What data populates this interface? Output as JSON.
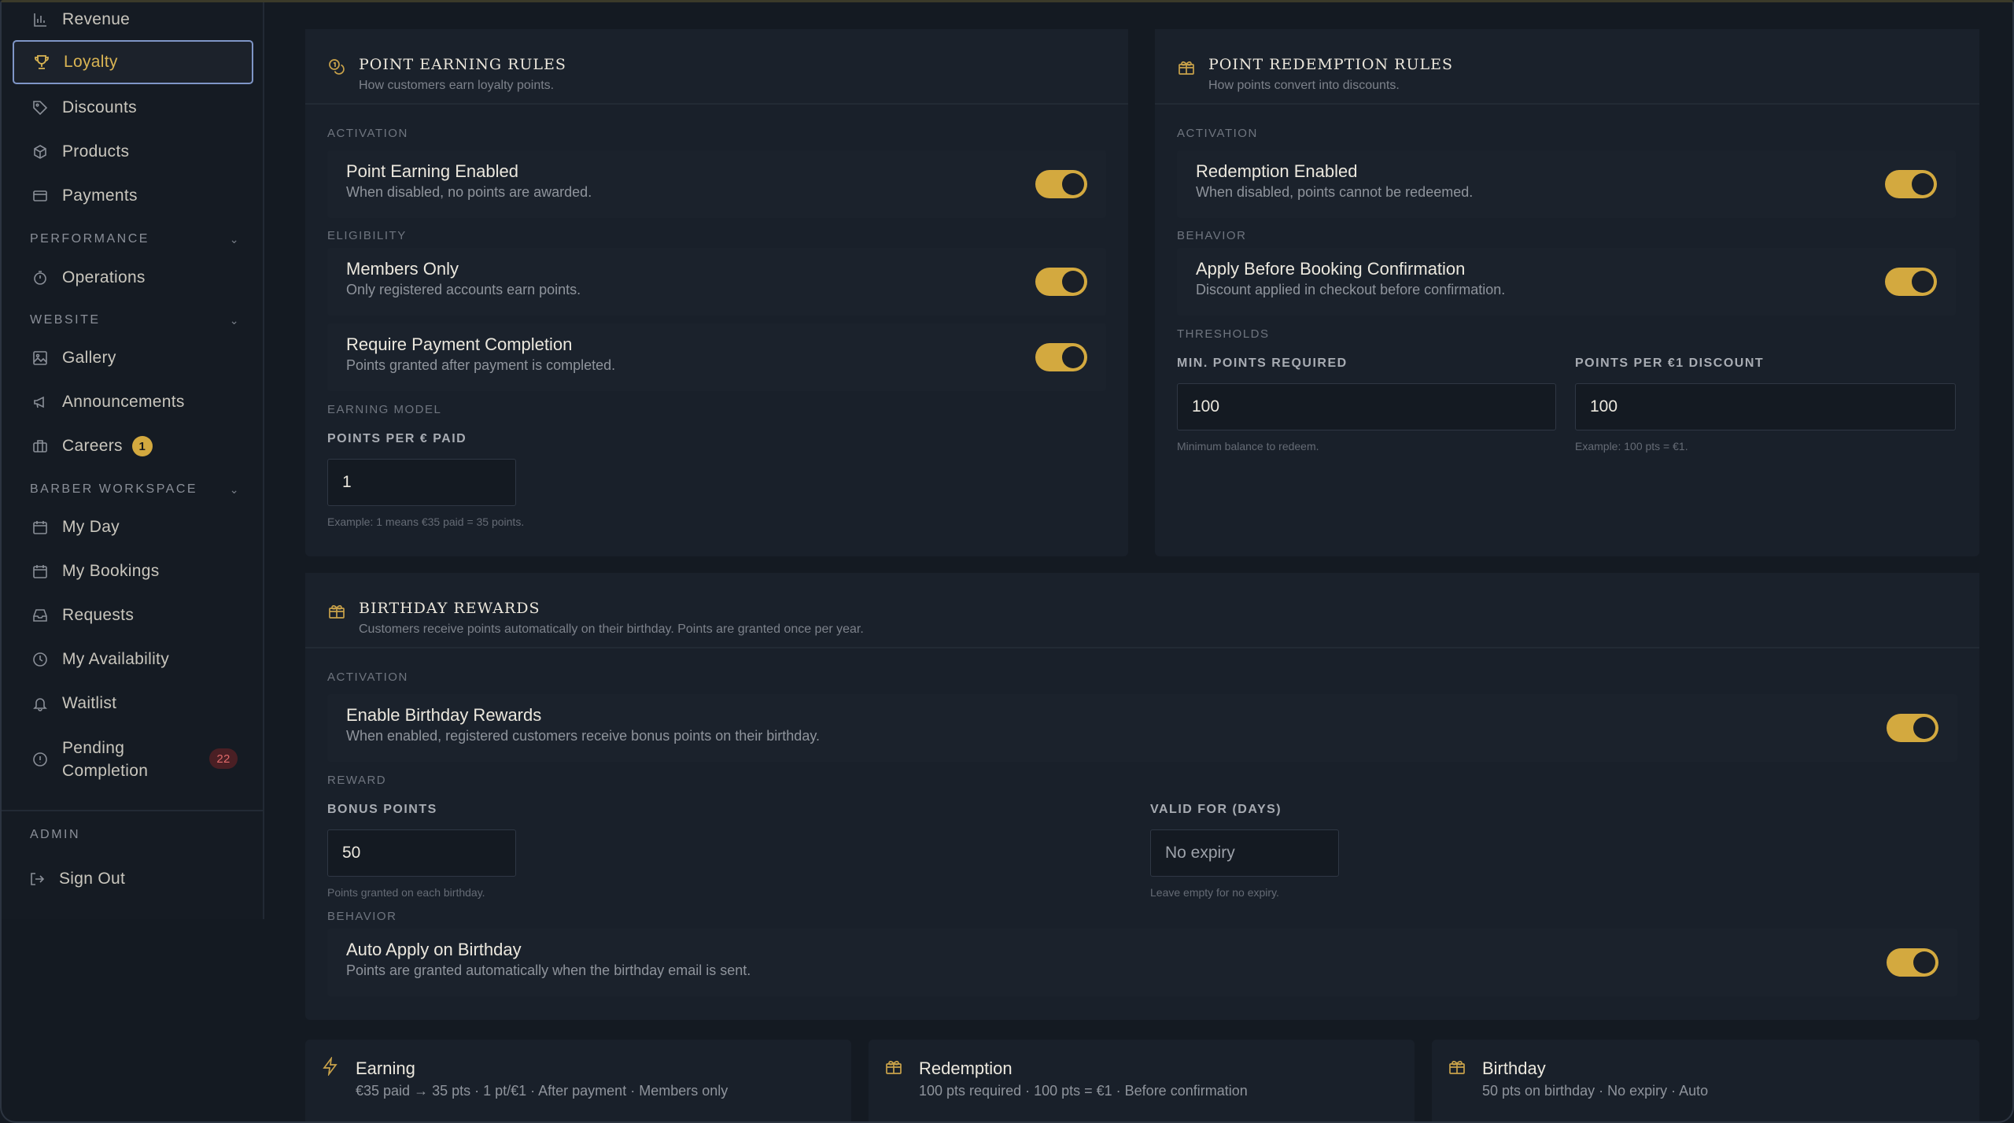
{
  "sidebar": {
    "items_top": [
      {
        "label": "Revenue",
        "icon": "bar-chart-icon"
      },
      {
        "label": "Loyalty",
        "icon": "trophy-icon"
      },
      {
        "label": "Discounts",
        "icon": "tag-icon"
      },
      {
        "label": "Products",
        "icon": "box-icon"
      },
      {
        "label": "Payments",
        "icon": "credit-card-icon"
      }
    ],
    "sections": {
      "performance": "PERFORMANCE",
      "website": "WEBSITE",
      "barber_workspace": "BARBER WORKSPACE",
      "admin": "ADMIN"
    },
    "operations": "Operations",
    "gallery": "Gallery",
    "announcements": "Announcements",
    "careers": "Careers",
    "careers_badge": "1",
    "my_day": "My Day",
    "my_bookings": "My Bookings",
    "requests": "Requests",
    "my_availability": "My Availability",
    "waitlist": "Waitlist",
    "pending_line1": "Pending",
    "pending_line2": "Completion",
    "pending_badge": "22",
    "sign_out": "Sign Out"
  },
  "earning": {
    "title": "POINT EARNING RULES",
    "subtitle": "How customers earn loyalty points.",
    "group_activation": "ACTIVATION",
    "enabled_title": "Point Earning Enabled",
    "enabled_desc": "When disabled, no points are awarded.",
    "group_eligibility": "ELIGIBILITY",
    "members_title": "Members Only",
    "members_desc": "Only registered accounts earn points.",
    "payment_title": "Require Payment Completion",
    "payment_desc": "Points granted after payment is completed.",
    "group_model": "EARNING MODEL",
    "ppe_label": "POINTS PER € PAID",
    "ppe_value": "1",
    "ppe_hint": "Example: 1 means €35 paid = 35 points."
  },
  "redemption": {
    "title": "POINT REDEMPTION RULES",
    "subtitle": "How points convert into discounts.",
    "group_activation": "ACTIVATION",
    "enabled_title": "Redemption Enabled",
    "enabled_desc": "When disabled, points cannot be redeemed.",
    "group_behavior": "BEHAVIOR",
    "apply_title": "Apply Before Booking Confirmation",
    "apply_desc": "Discount applied in checkout before confirmation.",
    "group_thresholds": "THRESHOLDS",
    "min_label": "MIN. POINTS REQUIRED",
    "min_value": "100",
    "min_hint": "Minimum balance to redeem.",
    "ppd_label": "POINTS PER €1 DISCOUNT",
    "ppd_value": "100",
    "ppd_hint": "Example: 100 pts = €1."
  },
  "birthday": {
    "title": "BIRTHDAY REWARDS",
    "subtitle": "Customers receive points automatically on their birthday. Points are granted once per year.",
    "group_activation": "ACTIVATION",
    "enable_title": "Enable Birthday Rewards",
    "enable_desc": "When enabled, registered customers receive bonus points on their birthday.",
    "group_reward": "REWARD",
    "bonus_label": "BONUS POINTS",
    "bonus_value": "50",
    "bonus_hint": "Points granted on each birthday.",
    "valid_label": "VALID FOR (DAYS)",
    "valid_placeholder": "No expiry",
    "valid_hint": "Leave empty for no expiry.",
    "group_behavior": "BEHAVIOR",
    "auto_title": "Auto Apply on Birthday",
    "auto_desc": "Points are granted automatically when the birthday email is sent."
  },
  "summary": {
    "earning_title": "Earning",
    "earning_desc": "€35 paid → 35 pts · 1 pt/€1 · After payment · Members only",
    "redemption_title": "Redemption",
    "redemption_desc": "100 pts required · 100 pts = €1 · Before confirmation",
    "birthday_title": "Birthday",
    "birthday_desc": "50 pts on birthday · No expiry · Auto"
  },
  "colors": {
    "accent": "#d3a93f",
    "background": "#141a22",
    "card": "#19202a"
  }
}
